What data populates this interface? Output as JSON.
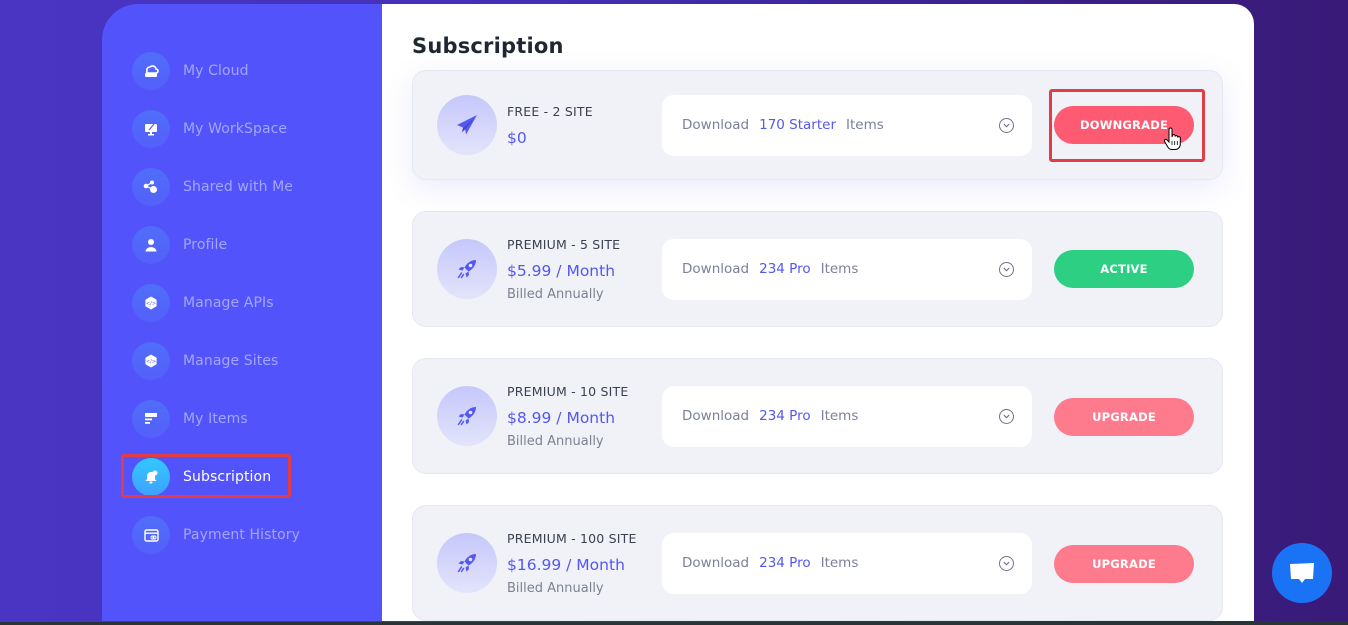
{
  "sidebar": {
    "items": [
      {
        "label": "My Cloud",
        "icon": "cloud-drive-icon",
        "active": false
      },
      {
        "label": "My WorkSpace",
        "icon": "workspace-monitor-icon",
        "active": false
      },
      {
        "label": "Shared with Me",
        "icon": "share-icon",
        "active": false
      },
      {
        "label": "Profile",
        "icon": "user-icon",
        "active": false
      },
      {
        "label": "Manage APIs",
        "icon": "api-gear-icon",
        "active": false
      },
      {
        "label": "Manage Sites",
        "icon": "sites-gear-icon",
        "active": false
      },
      {
        "label": "My Items",
        "icon": "items-list-icon",
        "active": false
      },
      {
        "label": "Subscription",
        "icon": "subscription-bell-icon",
        "active": true
      },
      {
        "label": "Payment History",
        "icon": "payment-card-icon",
        "active": false
      }
    ]
  },
  "main": {
    "title": "Subscription",
    "plans": [
      {
        "name": "FREE - 2 SITE",
        "price": "$0",
        "billing": "",
        "icon": "paper-plane-icon",
        "download_prefix": "Download",
        "download_count": "170 Starter",
        "download_suffix": "Items",
        "action": "DOWNGRADE",
        "action_type": "downgrade"
      },
      {
        "name": "PREMIUM - 5 SITE",
        "price": "$5.99 / Month",
        "billing": "Billed Annually",
        "icon": "rocket-icon",
        "download_prefix": "Download",
        "download_count": "234 Pro",
        "download_suffix": "Items",
        "action": "ACTIVE",
        "action_type": "active"
      },
      {
        "name": "PREMIUM - 10 SITE",
        "price": "$8.99 / Month",
        "billing": "Billed Annually",
        "icon": "rocket-icon",
        "download_prefix": "Download",
        "download_count": "234 Pro",
        "download_suffix": "Items",
        "action": "UPGRADE",
        "action_type": "upgrade"
      },
      {
        "name": "PREMIUM - 100 SITE",
        "price": "$16.99 / Month",
        "billing": "Billed Annually",
        "icon": "rocket-icon",
        "download_prefix": "Download",
        "download_count": "234 Pro",
        "download_suffix": "Items",
        "action": "UPGRADE",
        "action_type": "upgrade"
      }
    ]
  },
  "colors": {
    "sidebar_bg": "#5253fb",
    "accent": "#5457f2",
    "downgrade": "#fe5b73",
    "active": "#2dcf82",
    "upgrade": "#fe7b8e",
    "highlight": "#e23c47",
    "chat": "#1a73f5"
  }
}
